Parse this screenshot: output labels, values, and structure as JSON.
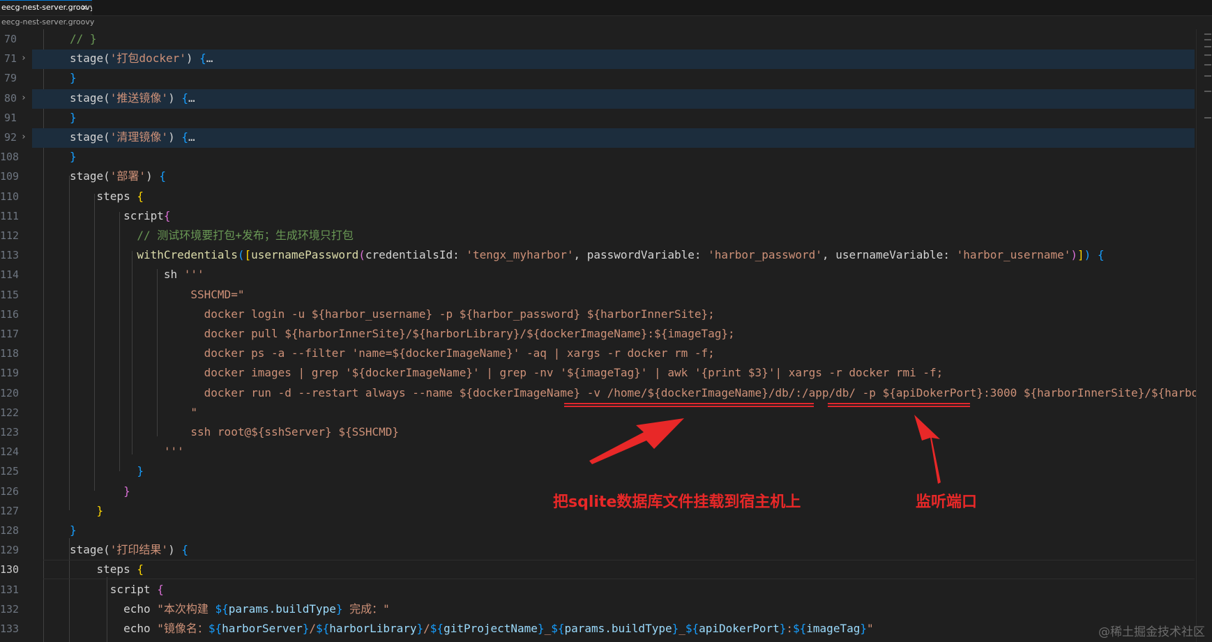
{
  "tab": {
    "title": "eecg-nest-server.groovy",
    "close": "✕"
  },
  "breadcrumb": "eecg-nest-server.groovy",
  "lines": [
    {
      "num": "70",
      "html": "<span class=\"cm\">// }</span>"
    },
    {
      "num": "71",
      "fold": "›",
      "hl": true,
      "html": "<span class=\"pl\">stage(</span><span class=\"str\">'打包docker'</span><span class=\"pl\">) </span><span class=\"b3\">{</span><span class=\"pl\">…</span>"
    },
    {
      "num": "79",
      "html": "<span class=\"b3\">}</span>"
    },
    {
      "num": "80",
      "fold": "›",
      "hl": true,
      "html": "<span class=\"pl\">stage(</span><span class=\"str\">'推送镜像'</span><span class=\"pl\">) </span><span class=\"b3\">{</span><span class=\"pl\">…</span>"
    },
    {
      "num": "91",
      "html": "<span class=\"b3\">}</span>"
    },
    {
      "num": "92",
      "fold": "›",
      "hl": true,
      "html": "<span class=\"pl\">stage(</span><span class=\"str\">'清理镜像'</span><span class=\"pl\">) </span><span class=\"b3\">{</span><span class=\"pl\">…</span>"
    },
    {
      "num": "108",
      "html": "<span class=\"b3\">}</span>"
    },
    {
      "num": "109",
      "html": "<span class=\"pl\">stage(</span><span class=\"str\">'部署'</span><span class=\"pl\">) </span><span class=\"b3\">{</span>"
    },
    {
      "num": "110",
      "html": "    <span class=\"pl\">steps </span><span class=\"b1\">{</span>"
    },
    {
      "num": "111",
      "html": "        <span class=\"pl\">script</span><span class=\"b2\">{</span>"
    },
    {
      "num": "112",
      "html": "          <span class=\"cm\">// 测试环境要打包+发布；生成环境只打包</span>"
    },
    {
      "num": "113",
      "html": "          <span class=\"kw\">withCredentials</span><span class=\"b3\">(</span><span class=\"b1\">[</span><span class=\"kw\">usernamePassword</span><span class=\"b2\">(</span><span class=\"pl\">credentialsId: </span><span class=\"str\">'tengx_myharbor'</span><span class=\"pl\">, passwordVariable: </span><span class=\"str\">'harbor_password'</span><span class=\"pl\">, usernameVariable: </span><span class=\"str\">'harbor_username'</span><span class=\"b2\">)</span><span class=\"b1\">]</span><span class=\"b3\">)</span><span class=\"pl\"> </span><span class=\"b3\">{</span>"
    },
    {
      "num": "114",
      "html": "              <span class=\"pl\">sh </span><span class=\"str\">'''</span>"
    },
    {
      "num": "115",
      "html": "                  <span class=\"str\">SSHCMD=\"</span>"
    },
    {
      "num": "116",
      "html": "                    <span class=\"str\">docker login -u ${harbor_username} -p ${harbor_password} ${harborInnerSite};</span>"
    },
    {
      "num": "117",
      "html": "                    <span class=\"str\">docker pull ${harborInnerSite}/${harborLibrary}/${dockerImageName}:${imageTag};</span>"
    },
    {
      "num": "118",
      "html": "                    <span class=\"str\">docker ps -a --filter 'name=${dockerImageName}' -aq | xargs -r docker rm -f;</span>"
    },
    {
      "num": "119",
      "html": "                    <span class=\"str\">docker images | grep '${dockerImageName}' | grep -nv '${imageTag}' | awk '{print $3}'| xargs -r docker rmi -f;</span>"
    },
    {
      "num": "120",
      "html": "                    <span class=\"str\">docker run -d --restart always --name ${dockerImageName} -v /home/${dockerImageName}/db/:/app/db/ -p ${apiDokerPort}:3000 ${harborInnerSite}/${harborLibrary}</span>"
    },
    {
      "num": "122",
      "html": "                  <span class=\"str\">\"</span>"
    },
    {
      "num": "123",
      "html": "                  <span class=\"str\">ssh root@${sshServer} ${SSHCMD}</span>"
    },
    {
      "num": "124",
      "html": "              <span class=\"str\">'''</span>"
    },
    {
      "num": "125",
      "html": "          <span class=\"b3\">}</span>"
    },
    {
      "num": "126",
      "html": "        <span class=\"b2\">}</span>"
    },
    {
      "num": "127",
      "html": "    <span class=\"b1\">}</span>"
    },
    {
      "num": "128",
      "html": "<span class=\"b3\">}</span>"
    },
    {
      "num": "129",
      "html": "<span class=\"pl\">stage(</span><span class=\"str\">'打印结果'</span><span class=\"pl\">) </span><span class=\"b3\">{</span>"
    },
    {
      "num": "130",
      "active": true,
      "html": "    <span class=\"pl\">steps </span><span class=\"b1\">{</span>"
    },
    {
      "num": "131",
      "html": "      <span class=\"pl\">script </span><span class=\"b2\">{</span>"
    },
    {
      "num": "132",
      "html": "        <span class=\"pl\">echo </span><span class=\"str\">\"本次构建 </span><span class=\"b3\">${</span><span class=\"vr\">params.buildType</span><span class=\"b3\">}</span><span class=\"str\"> 完成：\"</span>"
    },
    {
      "num": "133",
      "html": "        <span class=\"pl\">echo </span><span class=\"str\">\"镜像名：</span><span class=\"b3\">${</span><span class=\"vr\">harborServer</span><span class=\"b3\">}</span><span class=\"str\">/</span><span class=\"b3\">${</span><span class=\"vr\">harborLibrary</span><span class=\"b3\">}</span><span class=\"str\">/</span><span class=\"b3\">${</span><span class=\"vr\">gitProjectName</span><span class=\"b3\">}</span><span class=\"str\">_</span><span class=\"b3\">${</span><span class=\"vr\">params.buildType</span><span class=\"b3\">}</span><span class=\"str\">_</span><span class=\"b3\">${</span><span class=\"vr\">apiDokerPort</span><span class=\"b3\">}</span><span class=\"str\">:</span><span class=\"b3\">${</span><span class=\"vr\">imageTag</span><span class=\"b3\">}</span><span class=\"str\">\"</span>"
    }
  ],
  "annotations": {
    "mount_note": "把sqlite数据库文件挂载到宿主机上",
    "port_note": "监听端口"
  },
  "watermark": "@稀土掘金技术社区",
  "colors": {
    "annotation": "#e82828",
    "string": "#ce9178",
    "comment": "#6a9955",
    "function": "#dcdcaa"
  }
}
